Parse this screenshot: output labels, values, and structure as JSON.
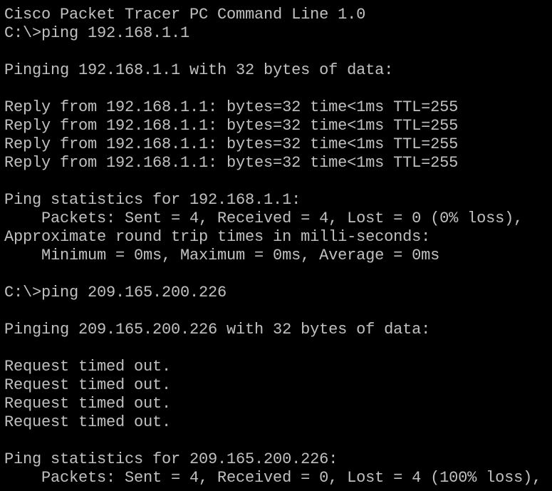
{
  "app": {
    "name": "Cisco Packet Tracer PC Command Line",
    "text_color": "#c0c0c0",
    "background_color": "#000000"
  },
  "terminal": {
    "lines": [
      "Cisco Packet Tracer PC Command Line 1.0",
      "C:\\>ping 192.168.1.1",
      "",
      "Pinging 192.168.1.1 with 32 bytes of data:",
      "",
      "Reply from 192.168.1.1: bytes=32 time<1ms TTL=255",
      "Reply from 192.168.1.1: bytes=32 time<1ms TTL=255",
      "Reply from 192.168.1.1: bytes=32 time<1ms TTL=255",
      "Reply from 192.168.1.1: bytes=32 time<1ms TTL=255",
      "",
      "Ping statistics for 192.168.1.1:",
      "    Packets: Sent = 4, Received = 4, Lost = 0 (0% loss),",
      "Approximate round trip times in milli-seconds:",
      "    Minimum = 0ms, Maximum = 0ms, Average = 0ms",
      "",
      "C:\\>ping 209.165.200.226",
      "",
      "Pinging 209.165.200.226 with 32 bytes of data:",
      "",
      "Request timed out.",
      "Request timed out.",
      "Request timed out.",
      "Request timed out.",
      "",
      "Ping statistics for 209.165.200.226:",
      "    Packets: Sent = 4, Received = 0, Lost = 4 (100% loss),"
    ]
  }
}
